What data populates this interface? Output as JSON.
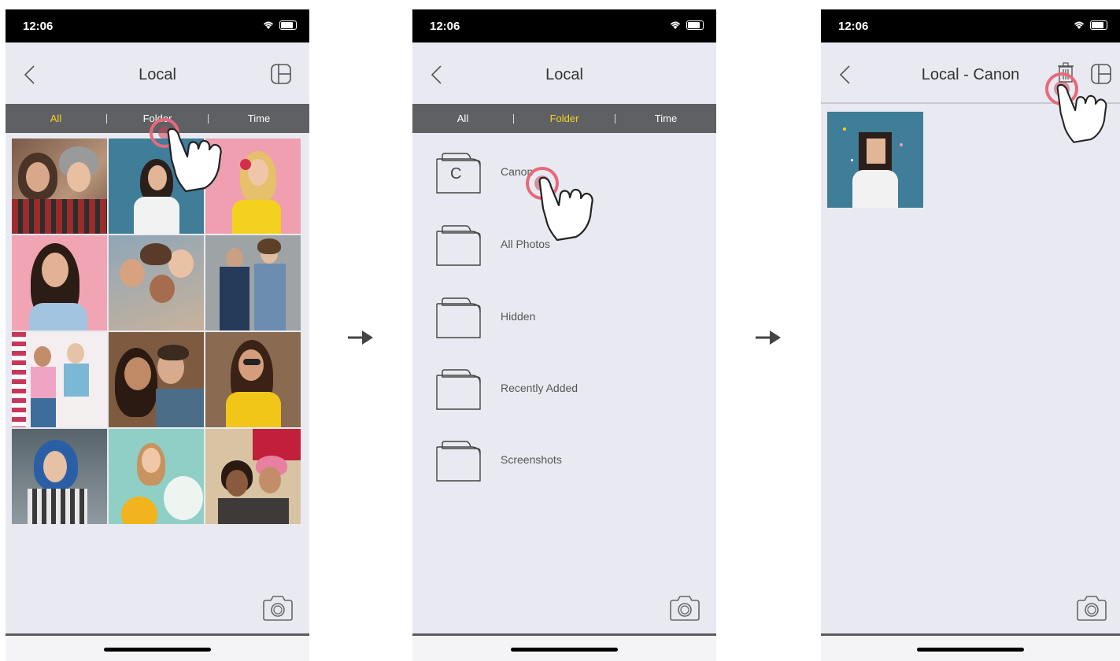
{
  "screens": [
    {
      "status": {
        "time": "12:06"
      },
      "nav": {
        "title": "Local"
      },
      "tabs": [
        "All",
        "Folder",
        "Time"
      ],
      "active_tab": "All"
    },
    {
      "status": {
        "time": "12:06"
      },
      "nav": {
        "title": "Local"
      },
      "tabs": [
        "All",
        "Folder",
        "Time"
      ],
      "active_tab": "Folder",
      "folders": [
        {
          "label": "Canon",
          "letter": "C"
        },
        {
          "label": "All Photos"
        },
        {
          "label": "Hidden"
        },
        {
          "label": "Recently Added"
        },
        {
          "label": "Screenshots"
        }
      ]
    },
    {
      "status": {
        "time": "12:06"
      },
      "nav": {
        "title": "Local - Canon"
      }
    }
  ],
  "colors": {
    "tab_active": "#f2d324",
    "tab_bar": "#5f6063",
    "tap_ring": "#e8697a",
    "background": "#e9eaf1"
  }
}
